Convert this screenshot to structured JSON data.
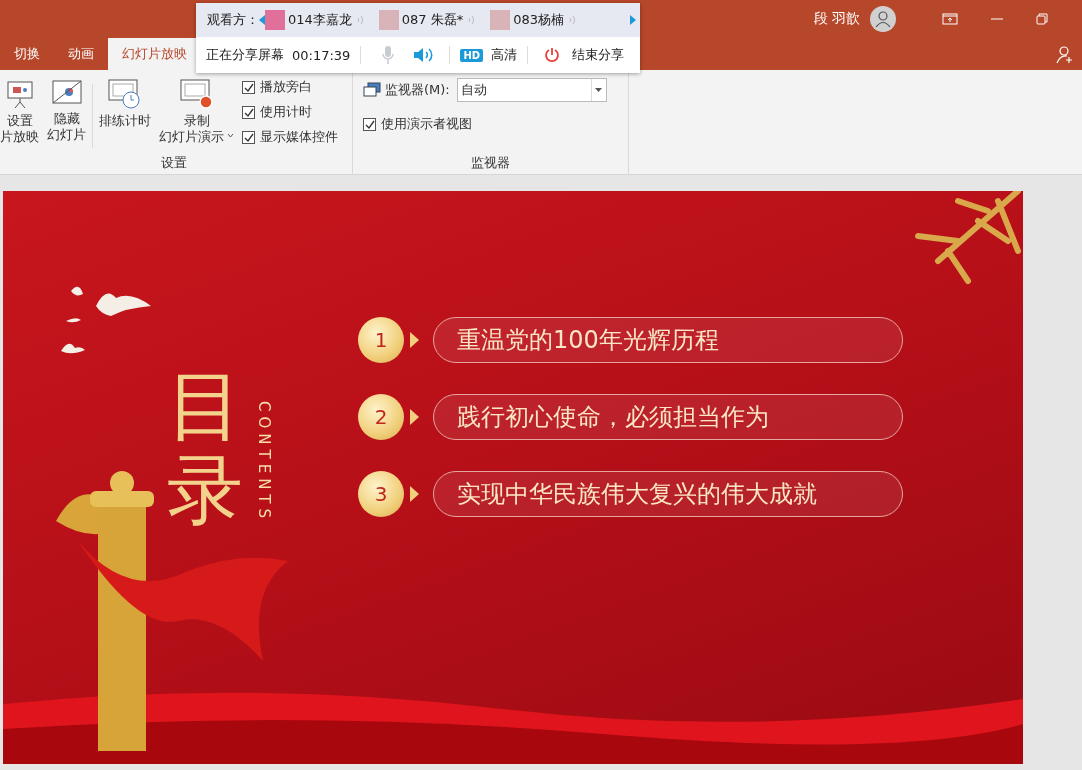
{
  "title_bar": {
    "user_name": "段 羽歆"
  },
  "tabs": [
    {
      "label": "切换",
      "selected": false
    },
    {
      "label": "动画",
      "selected": false
    },
    {
      "label": "幻灯片放映",
      "selected": true
    }
  ],
  "setup_group": {
    "label": "设置",
    "buttons": [
      {
        "kind": "setup",
        "lines": [
          "设置",
          "片放映"
        ],
        "dropdown": false
      },
      {
        "kind": "hide",
        "lines": [
          "隐藏",
          "幻灯片"
        ],
        "dropdown": false
      },
      {
        "kind": "rehearse",
        "lines": [
          "排练计时"
        ],
        "dropdown": false
      },
      {
        "kind": "record",
        "lines": [
          "录制",
          "幻灯片演示"
        ],
        "dropdown": true
      }
    ],
    "checkboxes": [
      {
        "label": "播放旁白",
        "checked": true
      },
      {
        "label": "使用计时",
        "checked": true
      },
      {
        "label": "显示媒体控件",
        "checked": true
      }
    ]
  },
  "monitor_group": {
    "label": "监视器",
    "monitor_label": "监视器(M):",
    "monitor_value": "自动",
    "presenter_view": {
      "label": "使用演示者视图",
      "checked": true
    }
  },
  "share": {
    "viewers_label": "观看方：",
    "viewers": [
      {
        "name": "014李嘉龙"
      },
      {
        "name": "087 朱磊*"
      },
      {
        "name": "083杨楠"
      }
    ],
    "status": "正在分享屏幕",
    "elapsed": "00:17:39",
    "mic_on": false,
    "speaker_on": true,
    "quality_badge": "HD",
    "quality_label": "高清",
    "end_label": "结束分享"
  },
  "slide": {
    "title": "目录",
    "subtitle": "CONTENTS",
    "items": [
      {
        "number": "1",
        "text": "重温党的100年光辉历程"
      },
      {
        "number": "2",
        "text": "践行初心使命，必须担当作为"
      },
      {
        "number": "3",
        "text": "实现中华民族伟大复兴的伟大成就"
      }
    ]
  }
}
